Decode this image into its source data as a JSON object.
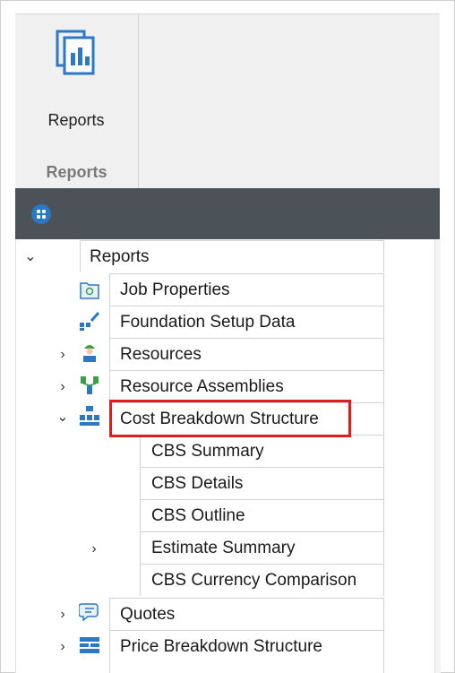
{
  "ribbon": {
    "button_label": "Reports",
    "group_label": "Reports",
    "button_icon": "reports-icon"
  },
  "toolbar": {
    "icon": "app-menu-icon",
    "accent": "#2b79c6"
  },
  "tree": {
    "root": {
      "label": "Reports",
      "expanded": true
    },
    "items": [
      {
        "label": "Job Properties",
        "icon": "folder-icon"
      },
      {
        "label": "Foundation Setup Data",
        "icon": "setup-icon"
      },
      {
        "label": "Resources",
        "icon": "worker-icon",
        "expandable": true
      },
      {
        "label": "Resource Assemblies",
        "icon": "assembly-icon",
        "expandable": true
      },
      {
        "label": "Cost Breakdown Structure",
        "icon": "cbs-icon",
        "expanded": true,
        "highlighted": true,
        "children": [
          {
            "label": "CBS Summary"
          },
          {
            "label": "CBS Details"
          },
          {
            "label": "CBS Outline"
          },
          {
            "label": "Estimate Summary",
            "expandable": true
          },
          {
            "label": "CBS Currency Comparison"
          }
        ]
      },
      {
        "label": "Quotes",
        "icon": "quotes-icon",
        "expandable": true
      },
      {
        "label": "Price Breakdown Structure",
        "icon": "pbs-icon",
        "expandable": true
      }
    ]
  },
  "colors": {
    "highlight_box": "#e21b1b",
    "toolbar_bg": "#4b5358",
    "ribbon_bg": "#f0f0f0"
  }
}
